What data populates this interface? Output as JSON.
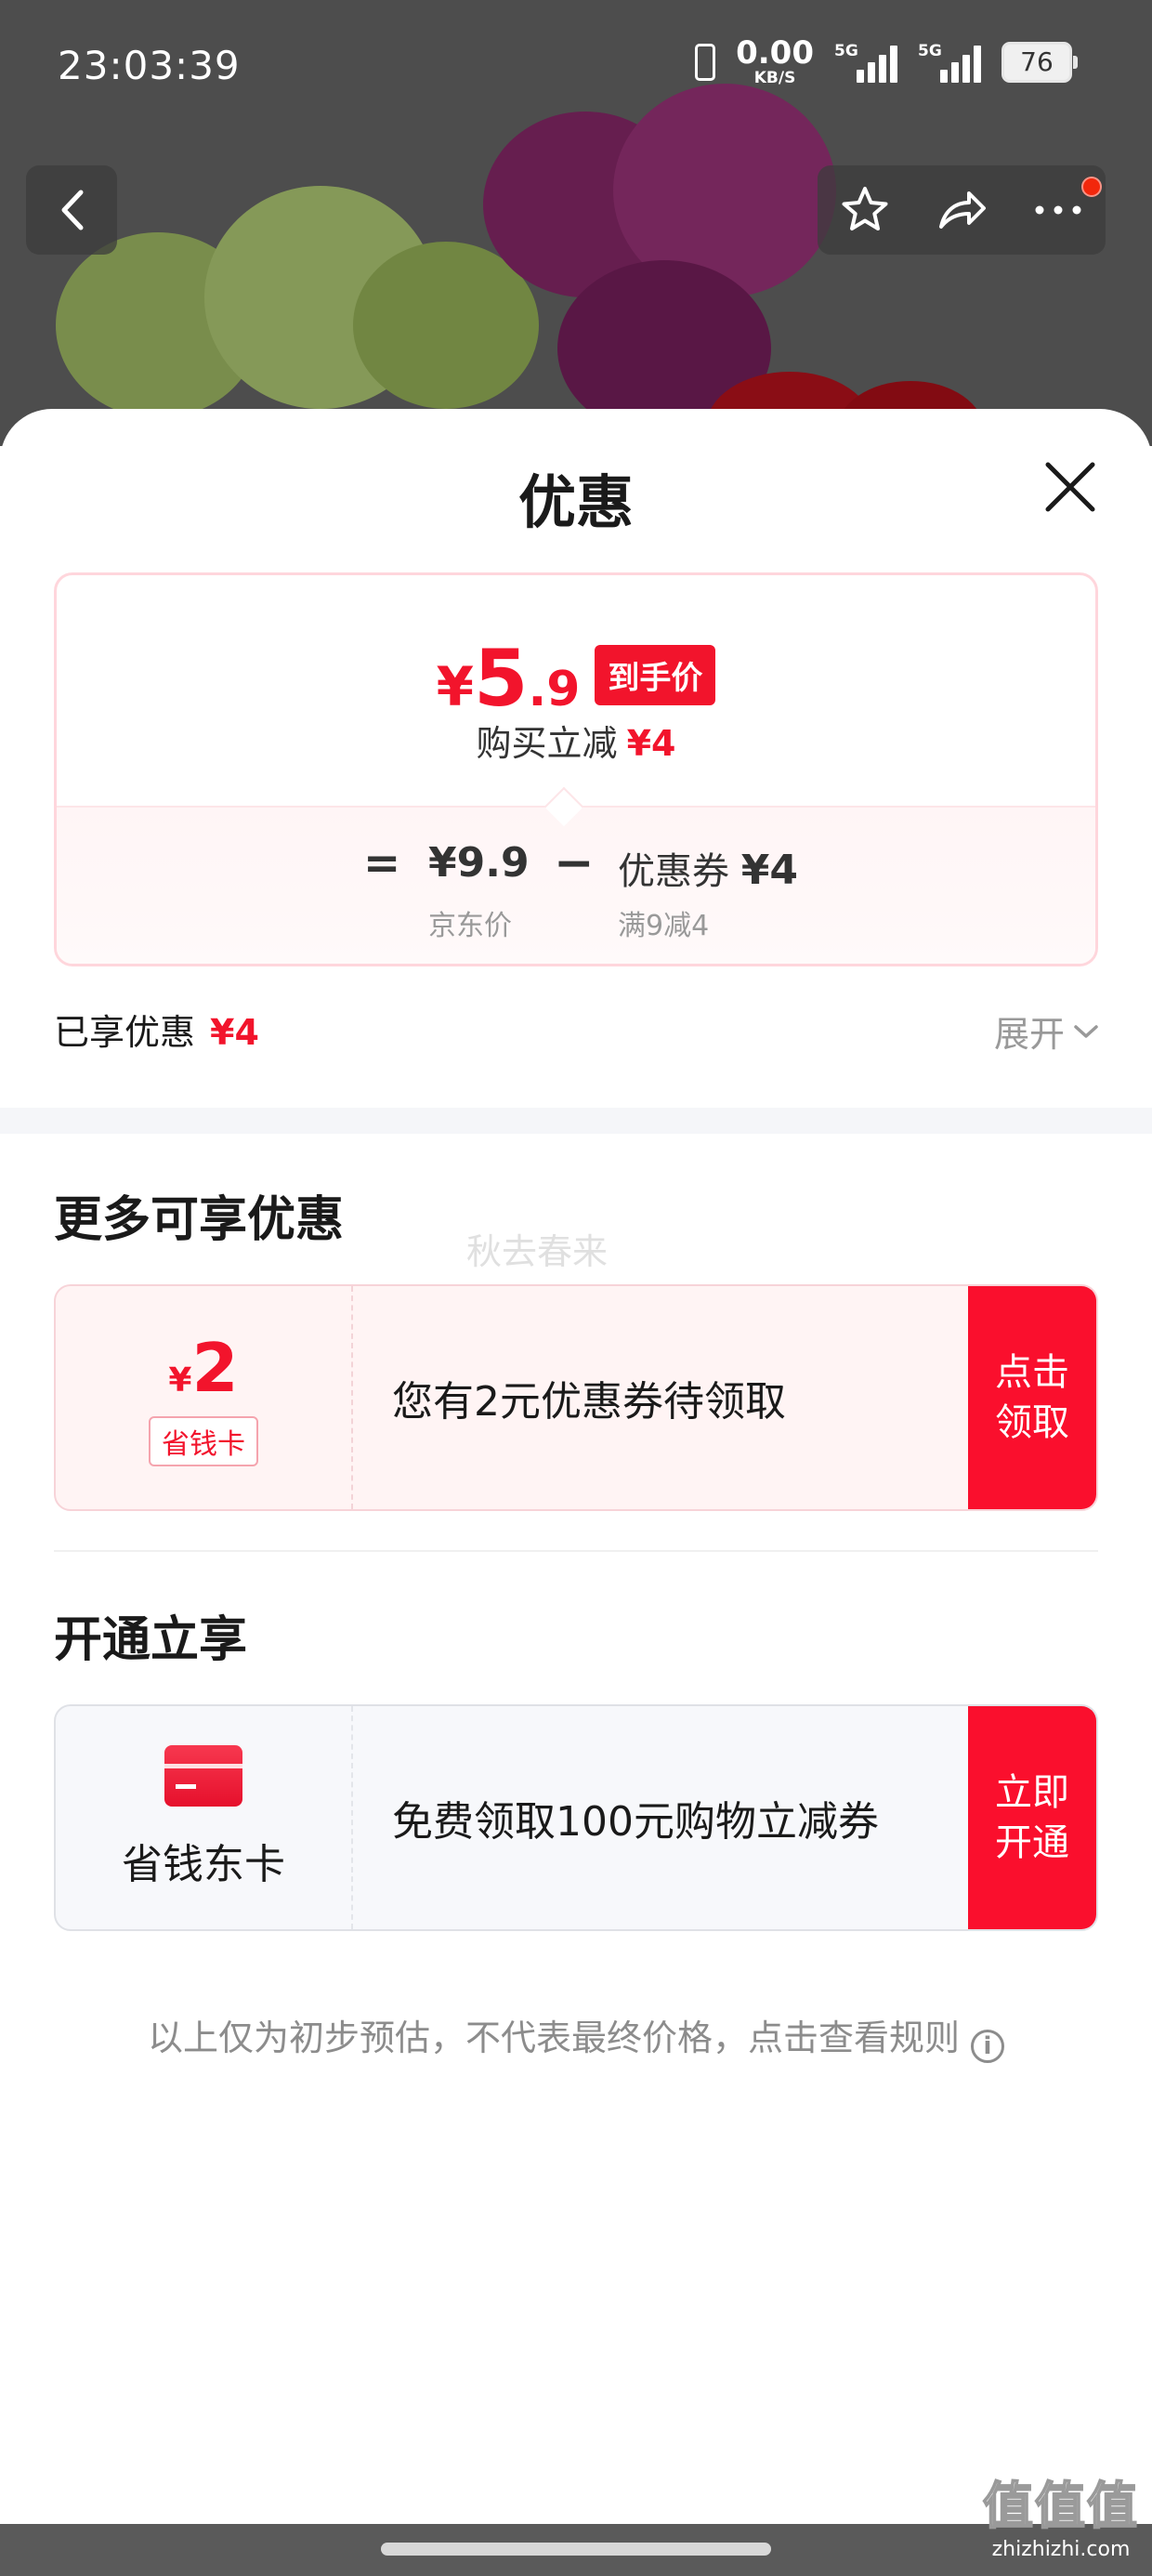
{
  "status_bar": {
    "time": "23:03:39",
    "net_speed_value": "0.00",
    "net_speed_unit": "KB/S",
    "signal1_label": "5G",
    "signal2_label": "5G",
    "battery": "76"
  },
  "sheet": {
    "title": "优惠",
    "price": {
      "currency": "¥",
      "integer": "5",
      "decimal": ".9",
      "tag": "到手价",
      "reduce_label": "购买立减",
      "reduce_amount": "¥4"
    },
    "breakdown": {
      "equals": "=",
      "minus": "−",
      "jd_price": "¥9.9",
      "jd_label": "京东价",
      "coupon_text": "优惠券",
      "coupon_amount": "¥4",
      "coupon_rule": "满9减4"
    },
    "enjoyed": {
      "label": "已享优惠",
      "amount": "¥4"
    },
    "expand_label": "展开",
    "more_section": {
      "title": "更多可享优惠",
      "watermark": "秋去春来",
      "coupon_card": {
        "currency": "¥",
        "value": "2",
        "badge": "省钱卡",
        "text": "您有2元优惠券待领取",
        "action_line1": "点击",
        "action_line2": "领取"
      }
    },
    "open_section": {
      "title": "开通立享",
      "card": {
        "name": "省钱东卡",
        "text": "免费领取100元购物立减券",
        "action_line1": "立即",
        "action_line2": "开通"
      }
    },
    "disclaimer": "以上仅为初步预估，不代表最终价格，点击查看规则"
  },
  "site_mark": {
    "logo": "值值值",
    "domain": "zhizhizhi.com"
  },
  "colors": {
    "accent_red": "#f2142c",
    "action_red": "#fa0f2d"
  }
}
